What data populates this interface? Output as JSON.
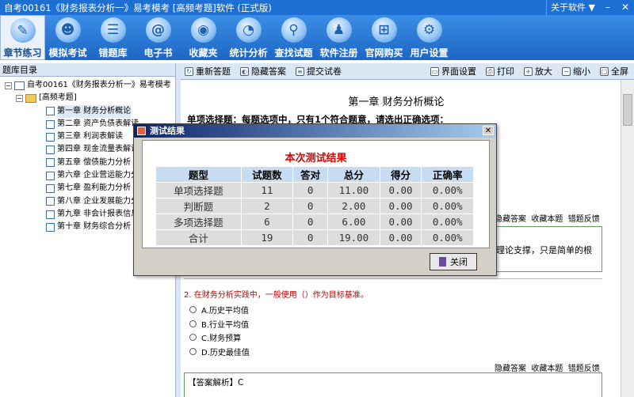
{
  "window": {
    "title": "自考00161《财务报表分析一》易考模考 [高频考题]软件 (正式版)",
    "about": "关于软件 ▼",
    "minimize": "–",
    "close": "✕"
  },
  "toolbar": [
    {
      "label": "章节练习",
      "icon": "pen-icon",
      "glyph": "✎",
      "active": true
    },
    {
      "label": "模拟考试",
      "icon": "robot-icon",
      "glyph": "☻"
    },
    {
      "label": "错题库",
      "icon": "list-icon",
      "glyph": "☰"
    },
    {
      "label": "电子书",
      "icon": "ebook-icon",
      "glyph": "@"
    },
    {
      "label": "收藏夹",
      "icon": "rss-icon",
      "glyph": "◉"
    },
    {
      "label": "统计分析",
      "icon": "pie-chart-icon",
      "glyph": "◔"
    },
    {
      "label": "查找试题",
      "icon": "search-icon",
      "glyph": "⚲"
    },
    {
      "label": "软件注册",
      "icon": "user-icon",
      "glyph": "♟"
    },
    {
      "label": "官网购买",
      "icon": "cart-icon",
      "glyph": "⊞"
    },
    {
      "label": "用户设置",
      "icon": "gear-icon",
      "glyph": "⚙"
    }
  ],
  "left": {
    "header": "题库目录",
    "root": "自考00161《财务报表分析一》易考模考",
    "folder": "[高频考题]",
    "chapters": [
      "第一章 财务分析概论",
      "第二章 资产负债表解读",
      "第三章 利润表解读",
      "第四章 现金流量表解读",
      "第五章 偿债能力分析",
      "第六章 企业营运能力分析",
      "第七章 盈利能力分析",
      "第八章 企业发展能力分析",
      "第九章 非会计报表信息",
      "第十章 财务综合分析"
    ]
  },
  "rtools": {
    "restart": "重新答题",
    "hide": "隐藏答案",
    "submit": "提交试卷",
    "settings": "界面设置",
    "print": "打印",
    "zoom_in": "放大",
    "zoom_out": "缩小",
    "fullscreen": "全屏"
  },
  "content": {
    "chapter_title": "第一章 财务分析概论",
    "qtype": "单项选择题：每题选项中，只有1个符合题意，请选出正确选项：",
    "links": {
      "hide": "隐藏答案",
      "fav": "收藏本题",
      "report": "错题反馈"
    },
    "box1_text": "理论支撑，只是简单的根",
    "q2": "2. 在财务分析实践中，一般使用（）作为目标基准。",
    "options": [
      "A.历史平均值",
      "B.行业平均值",
      "C.财务预算",
      "D.历史最佳值"
    ],
    "analysis": "【答案解析】C"
  },
  "dialog": {
    "title": "测试结果",
    "heading": "本次测试结果",
    "columns": [
      "题型",
      "试题数",
      "答对",
      "总分",
      "得分",
      "正确率"
    ],
    "rows": [
      [
        "单项选择题",
        "11",
        "0",
        "11.00",
        "0.00",
        "0.00%"
      ],
      [
        "判断题",
        "2",
        "0",
        "2.00",
        "0.00",
        "0.00%"
      ],
      [
        "多项选择题",
        "6",
        "0",
        "6.00",
        "0.00",
        "0.00%"
      ],
      [
        "合计",
        "19",
        "0",
        "19.00",
        "0.00",
        "0.00%"
      ]
    ],
    "close": "关闭"
  }
}
